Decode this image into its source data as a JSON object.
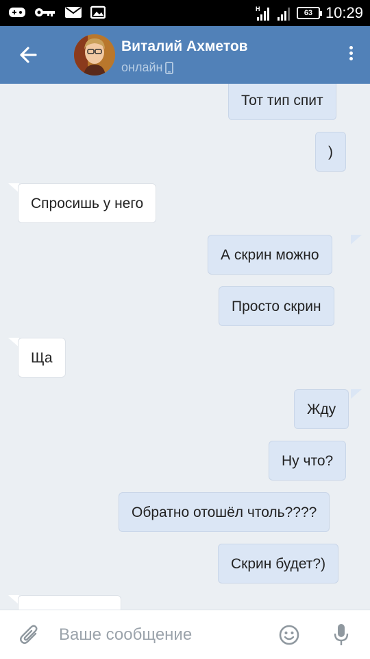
{
  "status_bar": {
    "time": "10:29",
    "battery": "63"
  },
  "header": {
    "name": "Виталий Ахметов",
    "status": "онлайн"
  },
  "messages": [
    {
      "direction": "out",
      "text": "Тот тип спит"
    },
    {
      "direction": "out",
      "text": ")"
    },
    {
      "direction": "in",
      "text": "Спросишь у него"
    },
    {
      "direction": "out",
      "text": "А скрин можно"
    },
    {
      "direction": "out",
      "text": "Просто скрин"
    },
    {
      "direction": "in",
      "text": "Ща"
    },
    {
      "direction": "out",
      "text": "Жду"
    },
    {
      "direction": "out",
      "text": "Ну что?"
    },
    {
      "direction": "out",
      "text": "Обратно отошёл чтоль????"
    },
    {
      "direction": "out",
      "text": "Скрин будет?)"
    }
  ],
  "composer": {
    "placeholder": "Ваше сообщение"
  },
  "colors": {
    "header": "#5181b8",
    "chat_bg": "#ebeff3",
    "outgoing_bubble": "#dbe6f5",
    "incoming_bubble": "#ffffff"
  }
}
